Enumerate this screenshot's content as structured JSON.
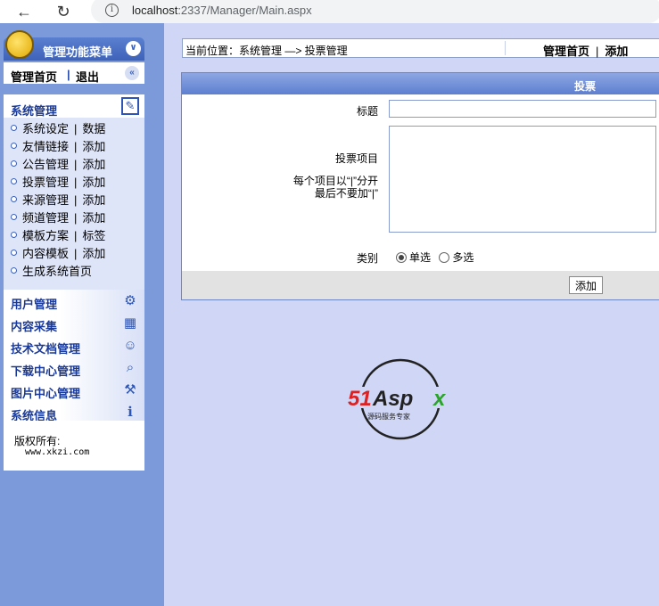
{
  "browser": {
    "url_host": "localhost",
    "url_rest": ":2337/Manager/Main.aspx"
  },
  "sidebar": {
    "menu_title": "管理功能菜单",
    "quick_home": "管理首页",
    "quick_sep": "|",
    "quick_logout": "退出",
    "system_title": "系统管理",
    "items": [
      {
        "a": "系统设定",
        "b": "数据"
      },
      {
        "a": "友情链接",
        "b": "添加"
      },
      {
        "a": "公告管理",
        "b": "添加"
      },
      {
        "a": "投票管理",
        "b": "添加"
      },
      {
        "a": "来源管理",
        "b": "添加"
      },
      {
        "a": "频道管理",
        "b": "添加"
      },
      {
        "a": "模板方案",
        "b": "标签"
      },
      {
        "a": "内容模板",
        "b": "添加"
      },
      {
        "a": "生成系统首页",
        "b": ""
      }
    ],
    "groups": [
      {
        "label": "用户管理",
        "icon": "users-icon"
      },
      {
        "label": "内容采集",
        "icon": "calendar-icon"
      },
      {
        "label": "技术文档管理",
        "icon": "person-icon"
      },
      {
        "label": "下载中心管理",
        "icon": "magnifier-icon"
      },
      {
        "label": "图片中心管理",
        "icon": "tools-icon"
      },
      {
        "label": "系统信息",
        "icon": "info-icon"
      }
    ],
    "copyright_label": "版权所有:",
    "copyright_url": "www.xkzi.com"
  },
  "location": {
    "text": "当前位置：系统管理 —> 投票管理",
    "link_home": "管理首页",
    "link_sep": "|",
    "link_add": "添加"
  },
  "form": {
    "title": "投票",
    "label_title": "标题",
    "title_value": "",
    "label_items": "投票项目",
    "hint_line1": "每个项目以“|”分开",
    "hint_line2": "最后不要加“|”",
    "items_value": "",
    "label_type": "类别",
    "option_single": "单选",
    "option_multi": "多选",
    "selected_option": "单选",
    "add_button": "添加"
  },
  "logo": {
    "brand": "51Aspx",
    "tagline": "源码服务专家",
    "colors": {
      "red": "#e02020",
      "green": "#2aa52a",
      "dark": "#222222"
    }
  },
  "colors": {
    "sidebar_bg": "#7c9ad9",
    "main_bg": "#d0d7f6",
    "header_blue": "#3d62b8"
  }
}
